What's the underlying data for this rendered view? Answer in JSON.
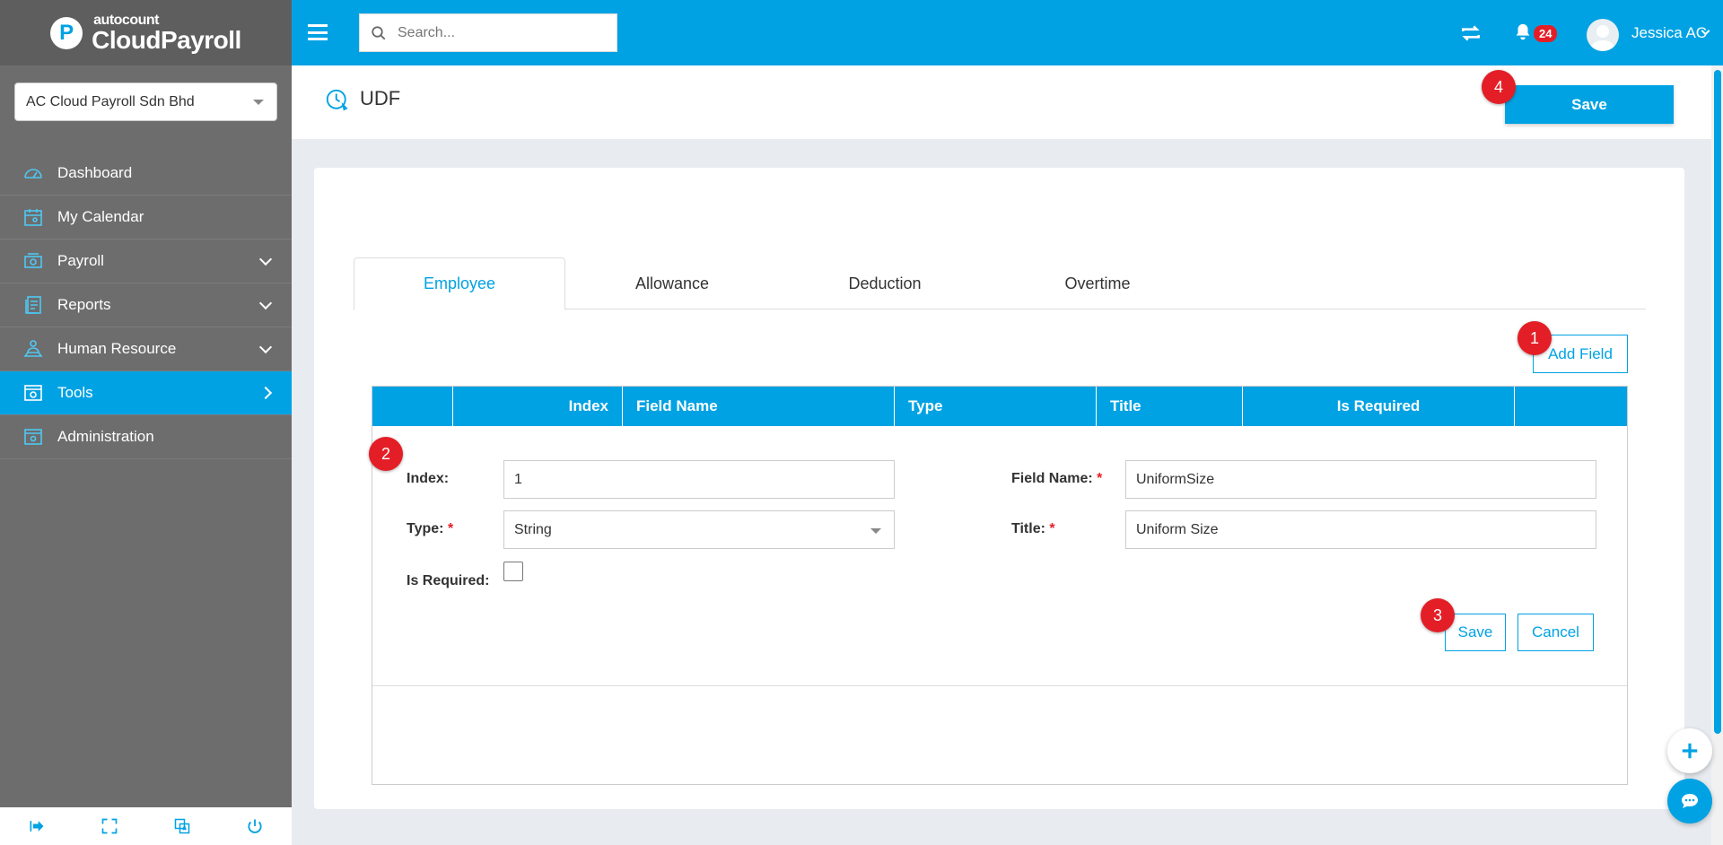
{
  "brand": {
    "small": "autocount",
    "big": "CloudPayroll",
    "logo_letter": "P"
  },
  "company": {
    "selected": "AC Cloud Payroll Sdn Bhd"
  },
  "nav": {
    "items": [
      {
        "label": "Dashboard",
        "icon": "dashboard-icon"
      },
      {
        "label": "My Calendar",
        "icon": "calendar-icon"
      },
      {
        "label": "Payroll",
        "icon": "payroll-icon"
      },
      {
        "label": "Reports",
        "icon": "reports-icon"
      },
      {
        "label": "Human Resource",
        "icon": "human-resource-icon"
      },
      {
        "label": "Tools",
        "icon": "tools-icon"
      },
      {
        "label": "Administration",
        "icon": "administration-icon"
      }
    ]
  },
  "topbar": {
    "search_placeholder": "Search...",
    "notification_count": "24",
    "user_name": "Jessica AC"
  },
  "page": {
    "title": "UDF",
    "save_label": "Save"
  },
  "tabs": [
    {
      "label": "Employee",
      "active": true
    },
    {
      "label": "Allowance",
      "active": false
    },
    {
      "label": "Deduction",
      "active": false
    },
    {
      "label": "Overtime",
      "active": false
    }
  ],
  "add_field_label": "Add Field",
  "grid": {
    "columns": [
      "",
      "Index",
      "Field Name",
      "Type",
      "Title",
      "Is Required",
      ""
    ]
  },
  "form": {
    "index_label": "Index:",
    "index_value": "1",
    "field_name_label": "Field Name:",
    "field_name_value": "UniformSize",
    "type_label": "Type:",
    "type_value": "String",
    "title_label": "Title:",
    "title_value": "Uniform Size",
    "is_required_label": "Is Required:",
    "is_required_checked": false,
    "required_mark": "*",
    "save_label": "Save",
    "cancel_label": "Cancel"
  },
  "steps": [
    "1",
    "2",
    "3",
    "4"
  ],
  "colors": {
    "accent": "#00a2e3",
    "sidebar": "#6d6d6d",
    "step_badge": "#e41e26"
  }
}
